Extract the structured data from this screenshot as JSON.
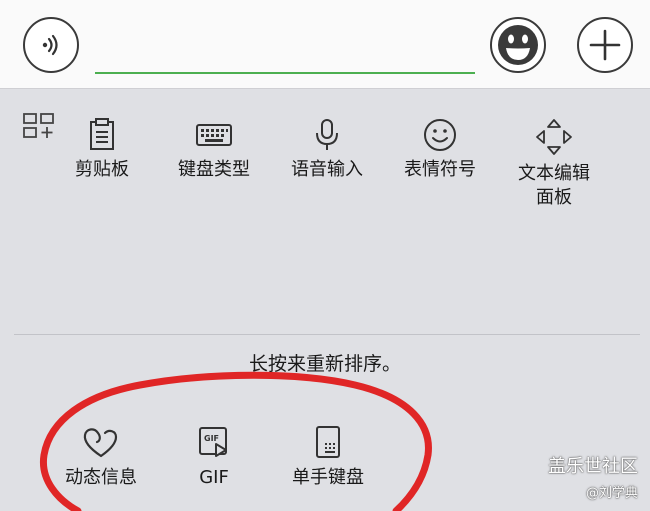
{
  "toolbar": {
    "input_value": "",
    "icons": [
      "voice-input-icon",
      "emoji-icon",
      "plus-icon"
    ]
  },
  "tools": [
    {
      "label": "剪贴板",
      "icon": "clipboard-icon"
    },
    {
      "label": "键盘类型",
      "icon": "keyboard-icon"
    },
    {
      "label": "语音输入",
      "icon": "microphone-icon"
    },
    {
      "label": "表情符号",
      "icon": "smiley-icon"
    },
    {
      "label": "文本编辑\n面板",
      "icon": "move-arrows-icon"
    }
  ],
  "hint": "长按来重新排序。",
  "extra_tools": [
    {
      "label": "动态信息",
      "icon": "heart-icon"
    },
    {
      "label": "GIF",
      "icon": "gif-icon"
    },
    {
      "label": "单手键盘",
      "icon": "one-hand-keyboard-icon"
    }
  ],
  "gif_icon_text": "GIF",
  "watermark": {
    "line1": "盖乐世社区",
    "line2": "@刘学典"
  },
  "colors": {
    "accent_underline": "#4caf50",
    "annotation": "#e02626",
    "panel_bg": "#dfe0e4"
  }
}
